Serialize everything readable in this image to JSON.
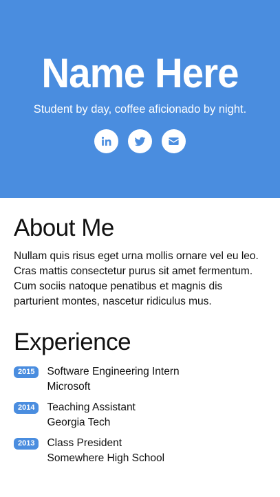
{
  "hero": {
    "name": "Name Here",
    "tagline": "Student by day, coffee aficionado by night.",
    "social": [
      {
        "icon": "linkedin-icon"
      },
      {
        "icon": "twitter-icon"
      },
      {
        "icon": "envelope-icon"
      }
    ]
  },
  "about": {
    "title": "About Me",
    "text": "Nullam quis risus eget urna mollis ornare vel eu leo. Cras mattis consectetur purus sit amet fermentum. Cum sociis natoque penatibus et magnis dis parturient montes, nascetur ridiculus mus."
  },
  "experience": {
    "title": "Experience",
    "items": [
      {
        "year": "2015",
        "role": "Software Engineering Intern",
        "org": "Microsoft"
      },
      {
        "year": "2014",
        "role": "Teaching Assistant",
        "org": "Georgia Tech"
      },
      {
        "year": "2013",
        "role": "Class President",
        "org": "Somewhere High School"
      }
    ]
  },
  "colors": {
    "accent": "#4a8ddf",
    "text": "#111111",
    "background": "#ffffff"
  }
}
